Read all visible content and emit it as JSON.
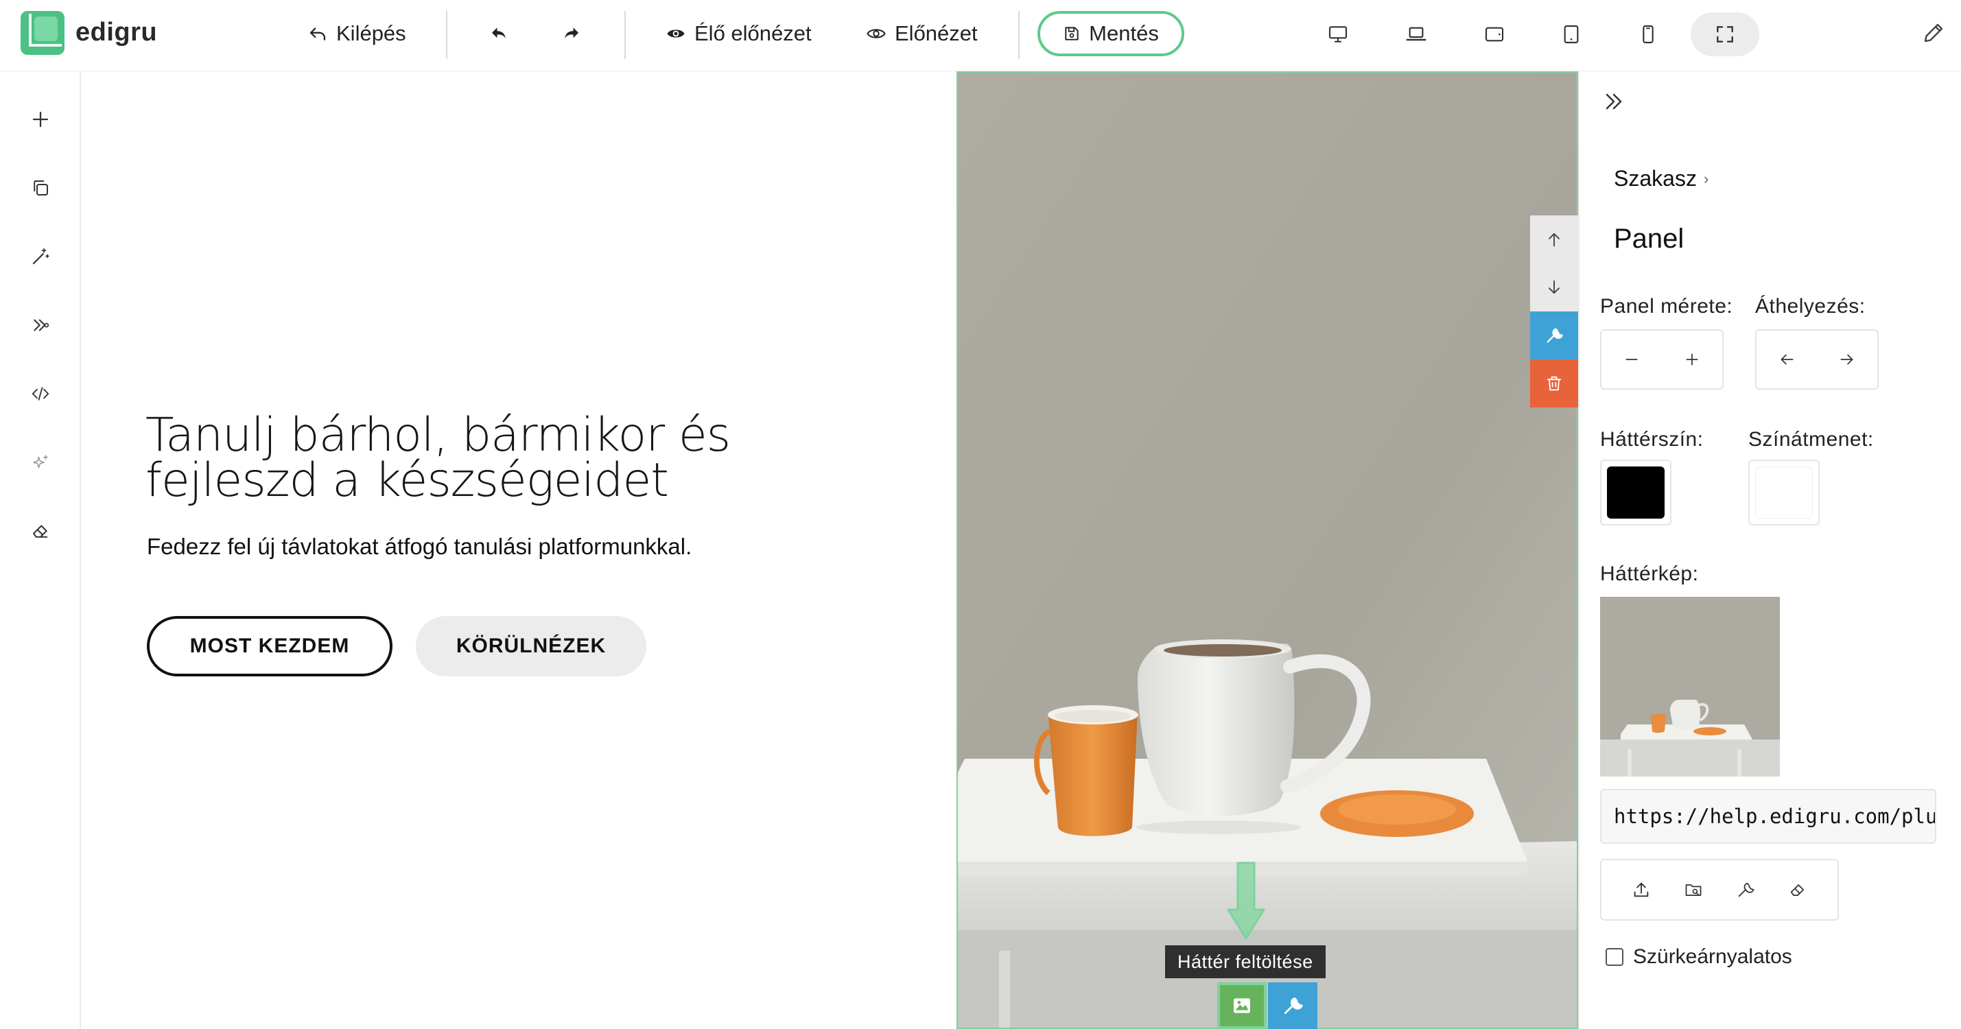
{
  "app": {
    "logo_text": "edigru",
    "brand_color": "#5ec98a"
  },
  "toolbar": {
    "exit_label": "Kilépés",
    "live_preview_label": "Élő előnézet",
    "preview_label": "Előnézet",
    "save_label": "Mentés",
    "devices": [
      "desktop-icon",
      "laptop-icon",
      "tablet-landscape-icon",
      "tablet-portrait-icon",
      "phone-icon",
      "fullscreen-icon"
    ]
  },
  "leftbar": {
    "items": [
      "plus-icon",
      "copy-icon",
      "magic-wand-icon",
      "layers-icon",
      "code-icon",
      "sparkles-icon",
      "eraser-icon"
    ]
  },
  "hero": {
    "title": "Tanulj bárhol, bármikor és fejleszd a készségeidet",
    "subtitle": "Fedezz fel új távlatokat átfogó tanulási platformunkkal.",
    "primary_button": "MOST KEZDEM",
    "secondary_button": "KÖRÜLNÉZEK"
  },
  "image_panel": {
    "tooltip": "Háttér feltöltése",
    "side_tools": [
      "arrow-up-icon",
      "arrow-down-icon",
      "wrench-icon",
      "trash-icon"
    ],
    "accent_blue": "#3ea2d6",
    "accent_orange": "#e8633a"
  },
  "settings": {
    "breadcrumb": "Szakasz",
    "title": "Panel",
    "panel_size_label": "Panel mérete:",
    "move_label": "Áthelyezés:",
    "bg_color_label": "Háttérszín:",
    "gradient_label": "Színátmenet:",
    "bg_color_value": "#000000",
    "gradient_value": "#ffffff",
    "bg_image_label": "Háttérkép:",
    "bg_image_url": "https://help.edigru.com/plugins",
    "image_tools": [
      "upload-icon",
      "folder-search-icon",
      "wrench-icon",
      "eraser-icon"
    ],
    "grayscale_label": "Szürkeárnyalatos",
    "grayscale_checked": false
  }
}
